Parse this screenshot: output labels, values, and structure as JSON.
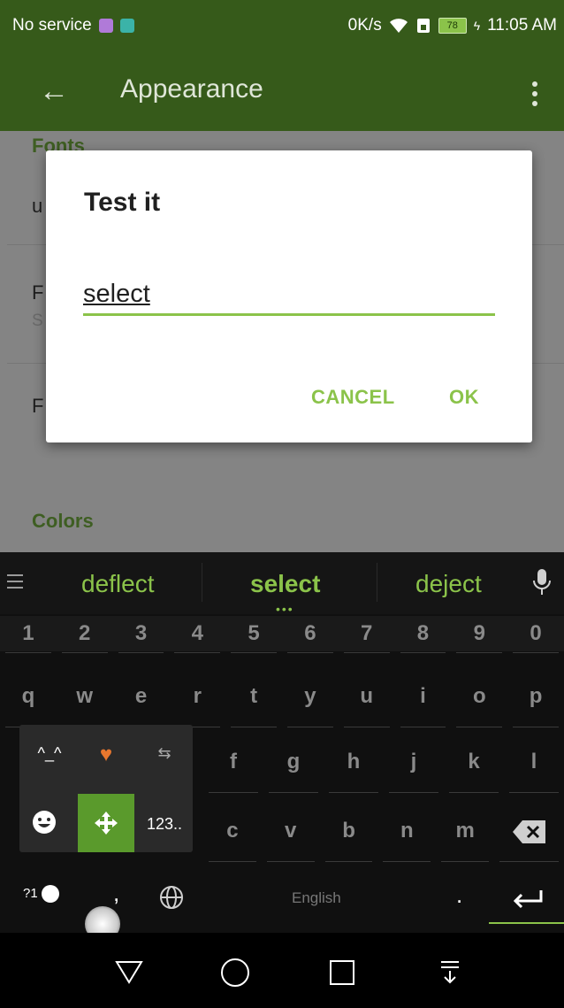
{
  "status_bar": {
    "carrier": "No service",
    "net_speed": "0K/s",
    "battery": "78",
    "time": "11:05 AM"
  },
  "app_bar": {
    "title": "Appearance"
  },
  "settings": {
    "fonts_header": "Fonts",
    "colors_header": "Colors",
    "row1_fragment": "u",
    "row2_fragment": "F",
    "row2_sub_fragment": "S",
    "row3_fragment": "F"
  },
  "dialog": {
    "title": "Test it",
    "input_value": "select",
    "cancel_label": "CANCEL",
    "ok_label": "OK",
    "accent_color": "#8bc34a"
  },
  "keyboard": {
    "suggestions": [
      "deflect",
      "select",
      "deject"
    ],
    "number_row": [
      "1",
      "2",
      "3",
      "4",
      "5",
      "6",
      "7",
      "8",
      "9",
      "0"
    ],
    "row_q": [
      "q",
      "w",
      "e",
      "r",
      "t",
      "y",
      "u",
      "i",
      "o",
      "p"
    ],
    "row_a_visible": [
      "f",
      "g",
      "h",
      "j",
      "k",
      "l"
    ],
    "row_z_visible": [
      "c",
      "v",
      "b",
      "n",
      "m"
    ],
    "popup": {
      "emoticon": "^_^",
      "numeric": "123.."
    },
    "bottom": {
      "symbols": "?1",
      "comma": ",",
      "space": "English",
      "period": "."
    }
  }
}
